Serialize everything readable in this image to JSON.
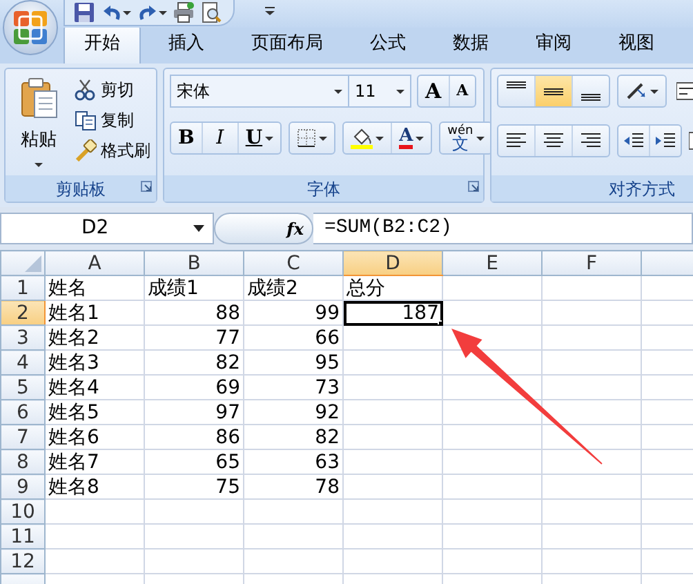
{
  "tabs": [
    {
      "label": "开始",
      "selected": true
    },
    {
      "label": "插入",
      "selected": false
    },
    {
      "label": "页面布局",
      "selected": false
    },
    {
      "label": "公式",
      "selected": false
    },
    {
      "label": "数据",
      "selected": false
    },
    {
      "label": "审阅",
      "selected": false
    },
    {
      "label": "视图",
      "selected": false
    }
  ],
  "ribbon": {
    "clipboard": {
      "paste": "粘贴",
      "cut": "剪切",
      "copy": "复制",
      "format_painter": "格式刷",
      "label": "剪贴板"
    },
    "font": {
      "font_name": "宋体",
      "font_size": "11",
      "grow": "A",
      "shrink": "A",
      "bold": "B",
      "italic": "I",
      "underline": "U",
      "font_color": "A",
      "phonetic_top": "wén",
      "phonetic_bottom": "文",
      "label": "字体"
    },
    "alignment": {
      "vertical": [
        {
          "kind": "top",
          "selected": false
        },
        {
          "kind": "middle",
          "selected": true
        },
        {
          "kind": "bottom",
          "selected": false
        }
      ],
      "label": "对齐方式"
    }
  },
  "formula_bar": {
    "name_box": "D2",
    "fx": "fx",
    "formula": "=SUM(B2:C2)"
  },
  "sheet": {
    "columns": [
      {
        "label": "A",
        "selected": false
      },
      {
        "label": "B",
        "selected": false
      },
      {
        "label": "C",
        "selected": false
      },
      {
        "label": "D",
        "selected": true
      },
      {
        "label": "E",
        "selected": false
      },
      {
        "label": "F",
        "selected": false
      }
    ],
    "rows": [
      {
        "header": "1",
        "selected": false,
        "cells": [
          {
            "text": "姓名",
            "kind": "text"
          },
          {
            "text": "成绩1",
            "kind": "text"
          },
          {
            "text": "成绩2",
            "kind": "text"
          },
          {
            "text": "总分",
            "kind": "text"
          }
        ]
      },
      {
        "header": "2",
        "selected": true,
        "cells": [
          {
            "text": "姓名1",
            "kind": "text"
          },
          {
            "text": "88",
            "kind": "number"
          },
          {
            "text": "99",
            "kind": "number"
          },
          {
            "text": "187",
            "kind": "number"
          }
        ]
      },
      {
        "header": "3",
        "selected": false,
        "cells": [
          {
            "text": "姓名2",
            "kind": "text"
          },
          {
            "text": "77",
            "kind": "number"
          },
          {
            "text": "66",
            "kind": "number"
          }
        ]
      },
      {
        "header": "4",
        "selected": false,
        "cells": [
          {
            "text": "姓名3",
            "kind": "text"
          },
          {
            "text": "82",
            "kind": "number"
          },
          {
            "text": "95",
            "kind": "number"
          }
        ]
      },
      {
        "header": "5",
        "selected": false,
        "cells": [
          {
            "text": "姓名4",
            "kind": "text"
          },
          {
            "text": "69",
            "kind": "number"
          },
          {
            "text": "73",
            "kind": "number"
          }
        ]
      },
      {
        "header": "6",
        "selected": false,
        "cells": [
          {
            "text": "姓名5",
            "kind": "text"
          },
          {
            "text": "97",
            "kind": "number"
          },
          {
            "text": "92",
            "kind": "number"
          }
        ]
      },
      {
        "header": "7",
        "selected": false,
        "cells": [
          {
            "text": "姓名6",
            "kind": "text"
          },
          {
            "text": "86",
            "kind": "number"
          },
          {
            "text": "82",
            "kind": "number"
          }
        ]
      },
      {
        "header": "8",
        "selected": false,
        "cells": [
          {
            "text": "姓名7",
            "kind": "text"
          },
          {
            "text": "65",
            "kind": "number"
          },
          {
            "text": "63",
            "kind": "number"
          }
        ]
      },
      {
        "header": "9",
        "selected": false,
        "cells": [
          {
            "text": "姓名8",
            "kind": "text"
          },
          {
            "text": "75",
            "kind": "number"
          },
          {
            "text": "78",
            "kind": "number"
          }
        ]
      },
      {
        "header": "10",
        "selected": false
      },
      {
        "header": "11",
        "selected": false
      },
      {
        "header": "12",
        "selected": false
      }
    ]
  }
}
